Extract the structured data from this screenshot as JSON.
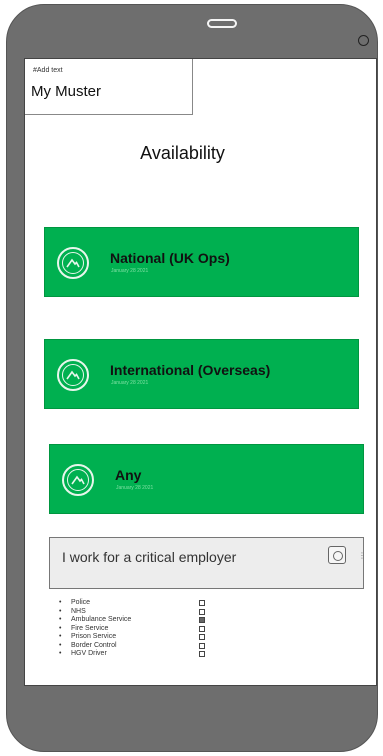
{
  "textbox": {
    "hint": "#Add text",
    "title": "My Muster"
  },
  "page_title": "Availability",
  "cards": [
    {
      "label": "National (UK Ops)",
      "date": "January 28 2021"
    },
    {
      "label": "International (Overseas)",
      "date": "January 28 2021"
    },
    {
      "label": "Any",
      "date": "January 28 2021"
    }
  ],
  "critical": {
    "text": "I work for a critical employer"
  },
  "employers": [
    {
      "name": "Police",
      "checked": false
    },
    {
      "name": "NHS",
      "checked": false
    },
    {
      "name": "Ambulance Service",
      "checked": true
    },
    {
      "name": "Fire Service",
      "checked": false
    },
    {
      "name": "Prison Service",
      "checked": false
    },
    {
      "name": "Border Control",
      "checked": false
    },
    {
      "name": "HGV Driver",
      "checked": false
    }
  ],
  "colors": {
    "accent": "#00b050",
    "phone_frame": "#6e6e6e"
  }
}
